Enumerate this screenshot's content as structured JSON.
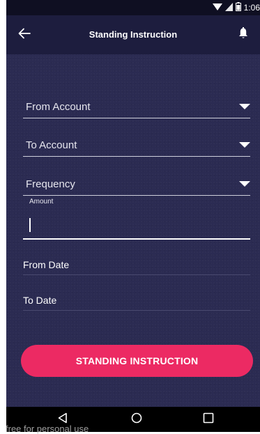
{
  "statusbar": {
    "time": "1:06",
    "icons": [
      "wifi-icon",
      "signal-icon",
      "battery-icon"
    ]
  },
  "appbar": {
    "title": "Standing Instruction",
    "back_icon": "arrow-left-icon",
    "notification_icon": "bell-icon"
  },
  "form": {
    "from_account": {
      "label": "From Account"
    },
    "to_account": {
      "label": "To Account"
    },
    "frequency": {
      "label": "Frequency"
    },
    "amount": {
      "label": "Amount",
      "value": ""
    },
    "from_date": {
      "label": "From Date"
    },
    "to_date": {
      "label": "To Date"
    }
  },
  "submit": {
    "label": "STANDING INSTRUCTION"
  },
  "navbar": {
    "icons": [
      "back-triangle-icon",
      "home-circle-icon",
      "recents-square-icon"
    ]
  },
  "watermark": "free for personal use",
  "colors": {
    "background": "#2b2b52",
    "appbar": "#1d1d3e",
    "accent": "#ec2a63"
  }
}
